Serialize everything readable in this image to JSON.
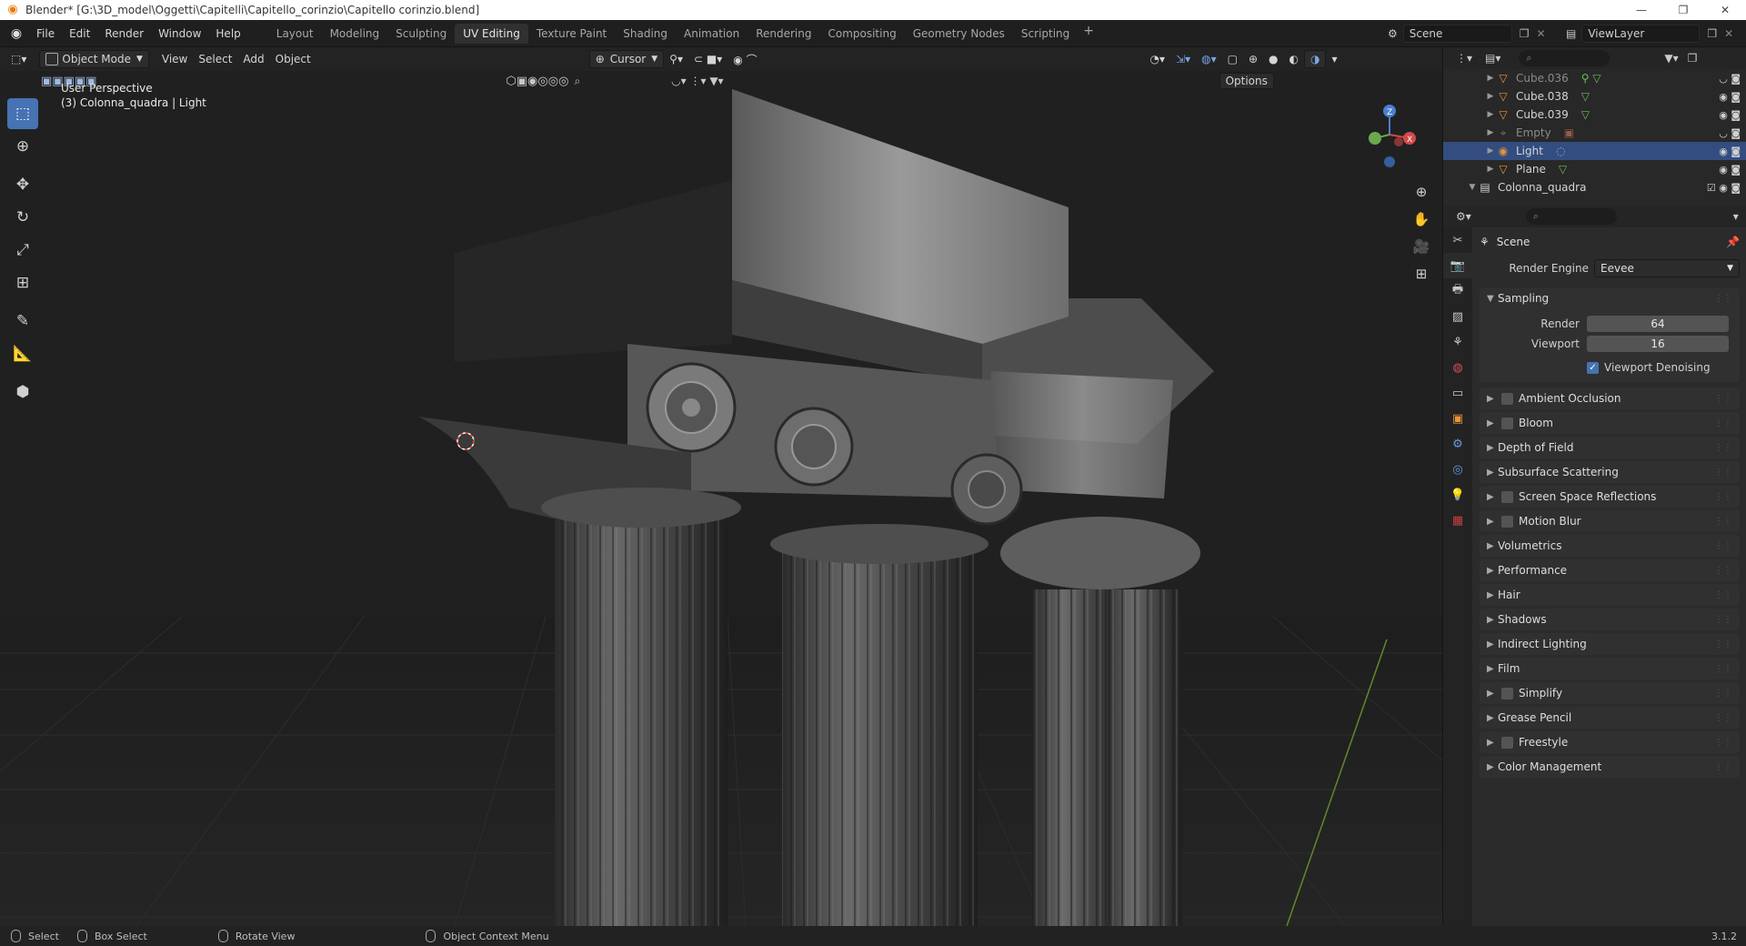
{
  "window": {
    "title": "Blender* [G:\\3D_model\\Oggetti\\Capitelli\\Capitello_corinzio\\Capitello corinzio.blend]",
    "minimize": "—",
    "maximize": "❐",
    "close": "✕"
  },
  "menu": [
    "File",
    "Edit",
    "Render",
    "Window",
    "Help"
  ],
  "workspaces": [
    {
      "label": "Layout",
      "active": false
    },
    {
      "label": "Modeling",
      "active": false
    },
    {
      "label": "Sculpting",
      "active": false
    },
    {
      "label": "UV Editing",
      "active": true
    },
    {
      "label": "Texture Paint",
      "active": false
    },
    {
      "label": "Shading",
      "active": false
    },
    {
      "label": "Animation",
      "active": false
    },
    {
      "label": "Rendering",
      "active": false
    },
    {
      "label": "Compositing",
      "active": false
    },
    {
      "label": "Geometry Nodes",
      "active": false
    },
    {
      "label": "Scripting",
      "active": false
    }
  ],
  "workspace_add": "+",
  "scene_name": "Scene",
  "view_layer": "ViewLayer",
  "viewport_header": {
    "mode": "Object Mode",
    "menus": [
      "View",
      "Select",
      "Add",
      "Object"
    ],
    "pivot": "Cursor",
    "options": "Options"
  },
  "viewport": {
    "perspective": "User Perspective",
    "context": "(3) Colonna_quadra | Light"
  },
  "outliner": {
    "items": [
      {
        "name": "Cube.036",
        "dim": true,
        "selected": false
      },
      {
        "name": "Cube.038",
        "dim": false,
        "selected": false
      },
      {
        "name": "Cube.039",
        "dim": false,
        "selected": false
      },
      {
        "name": "Empty",
        "dim": true,
        "selected": false
      },
      {
        "name": "Light",
        "dim": false,
        "selected": true
      },
      {
        "name": "Plane",
        "dim": false,
        "selected": false
      }
    ],
    "collection": "Colonna_quadra"
  },
  "properties": {
    "scene_label": "Scene",
    "render_engine_label": "Render Engine",
    "render_engine_value": "Eevee",
    "sampling": {
      "title": "Sampling",
      "render_label": "Render",
      "render_value": "64",
      "viewport_label": "Viewport",
      "viewport_value": "16",
      "denoise_label": "Viewport Denoising"
    },
    "panels": [
      {
        "label": "Ambient Occlusion",
        "checkbox": true
      },
      {
        "label": "Bloom",
        "checkbox": true
      },
      {
        "label": "Depth of Field",
        "checkbox": false
      },
      {
        "label": "Subsurface Scattering",
        "checkbox": false
      },
      {
        "label": "Screen Space Reflections",
        "checkbox": true
      },
      {
        "label": "Motion Blur",
        "checkbox": true
      },
      {
        "label": "Volumetrics",
        "checkbox": false
      },
      {
        "label": "Performance",
        "checkbox": false
      },
      {
        "label": "Hair",
        "checkbox": false
      },
      {
        "label": "Shadows",
        "checkbox": false
      },
      {
        "label": "Indirect Lighting",
        "checkbox": false
      },
      {
        "label": "Film",
        "checkbox": false
      },
      {
        "label": "Simplify",
        "checkbox": true
      },
      {
        "label": "Grease Pencil",
        "checkbox": false
      },
      {
        "label": "Freestyle",
        "checkbox": true
      },
      {
        "label": "Color Management",
        "checkbox": false
      }
    ]
  },
  "statusbar": {
    "select": "Select",
    "box_select": "Box Select",
    "rotate": "Rotate View",
    "context_menu": "Object Context Menu",
    "version": "3.1.2"
  },
  "colors": {
    "accent": "#4772b3",
    "selected_row": "#334d80",
    "object_icon": "#e8943a",
    "mesh_data": "#6bbf59"
  }
}
